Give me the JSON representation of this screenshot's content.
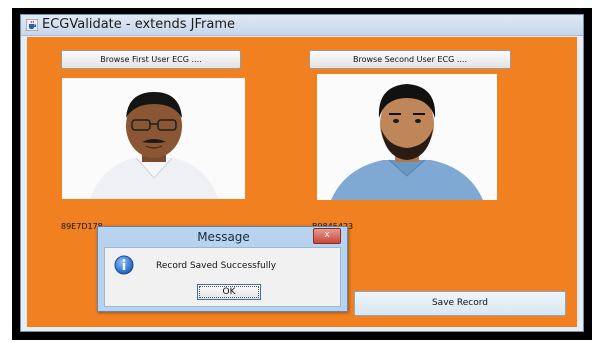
{
  "window": {
    "title": "ECGValidate - extends JFrame"
  },
  "user1": {
    "browse_label": "Browse First User ECG ....",
    "id_label": "89E7D178"
  },
  "user2": {
    "browse_label": "Browse Second User ECG ....",
    "id_label": "B9845423"
  },
  "save_label": "Save Record",
  "dialog": {
    "title": "Message",
    "close_label": "x",
    "message": "Record Saved Successfully",
    "ok_label": "OK"
  },
  "colors": {
    "panel_background": "#f08020",
    "dialog_frame": "#b8d3f0"
  },
  "icons": {
    "window": "java-cup-icon",
    "dialog": "info-icon"
  }
}
